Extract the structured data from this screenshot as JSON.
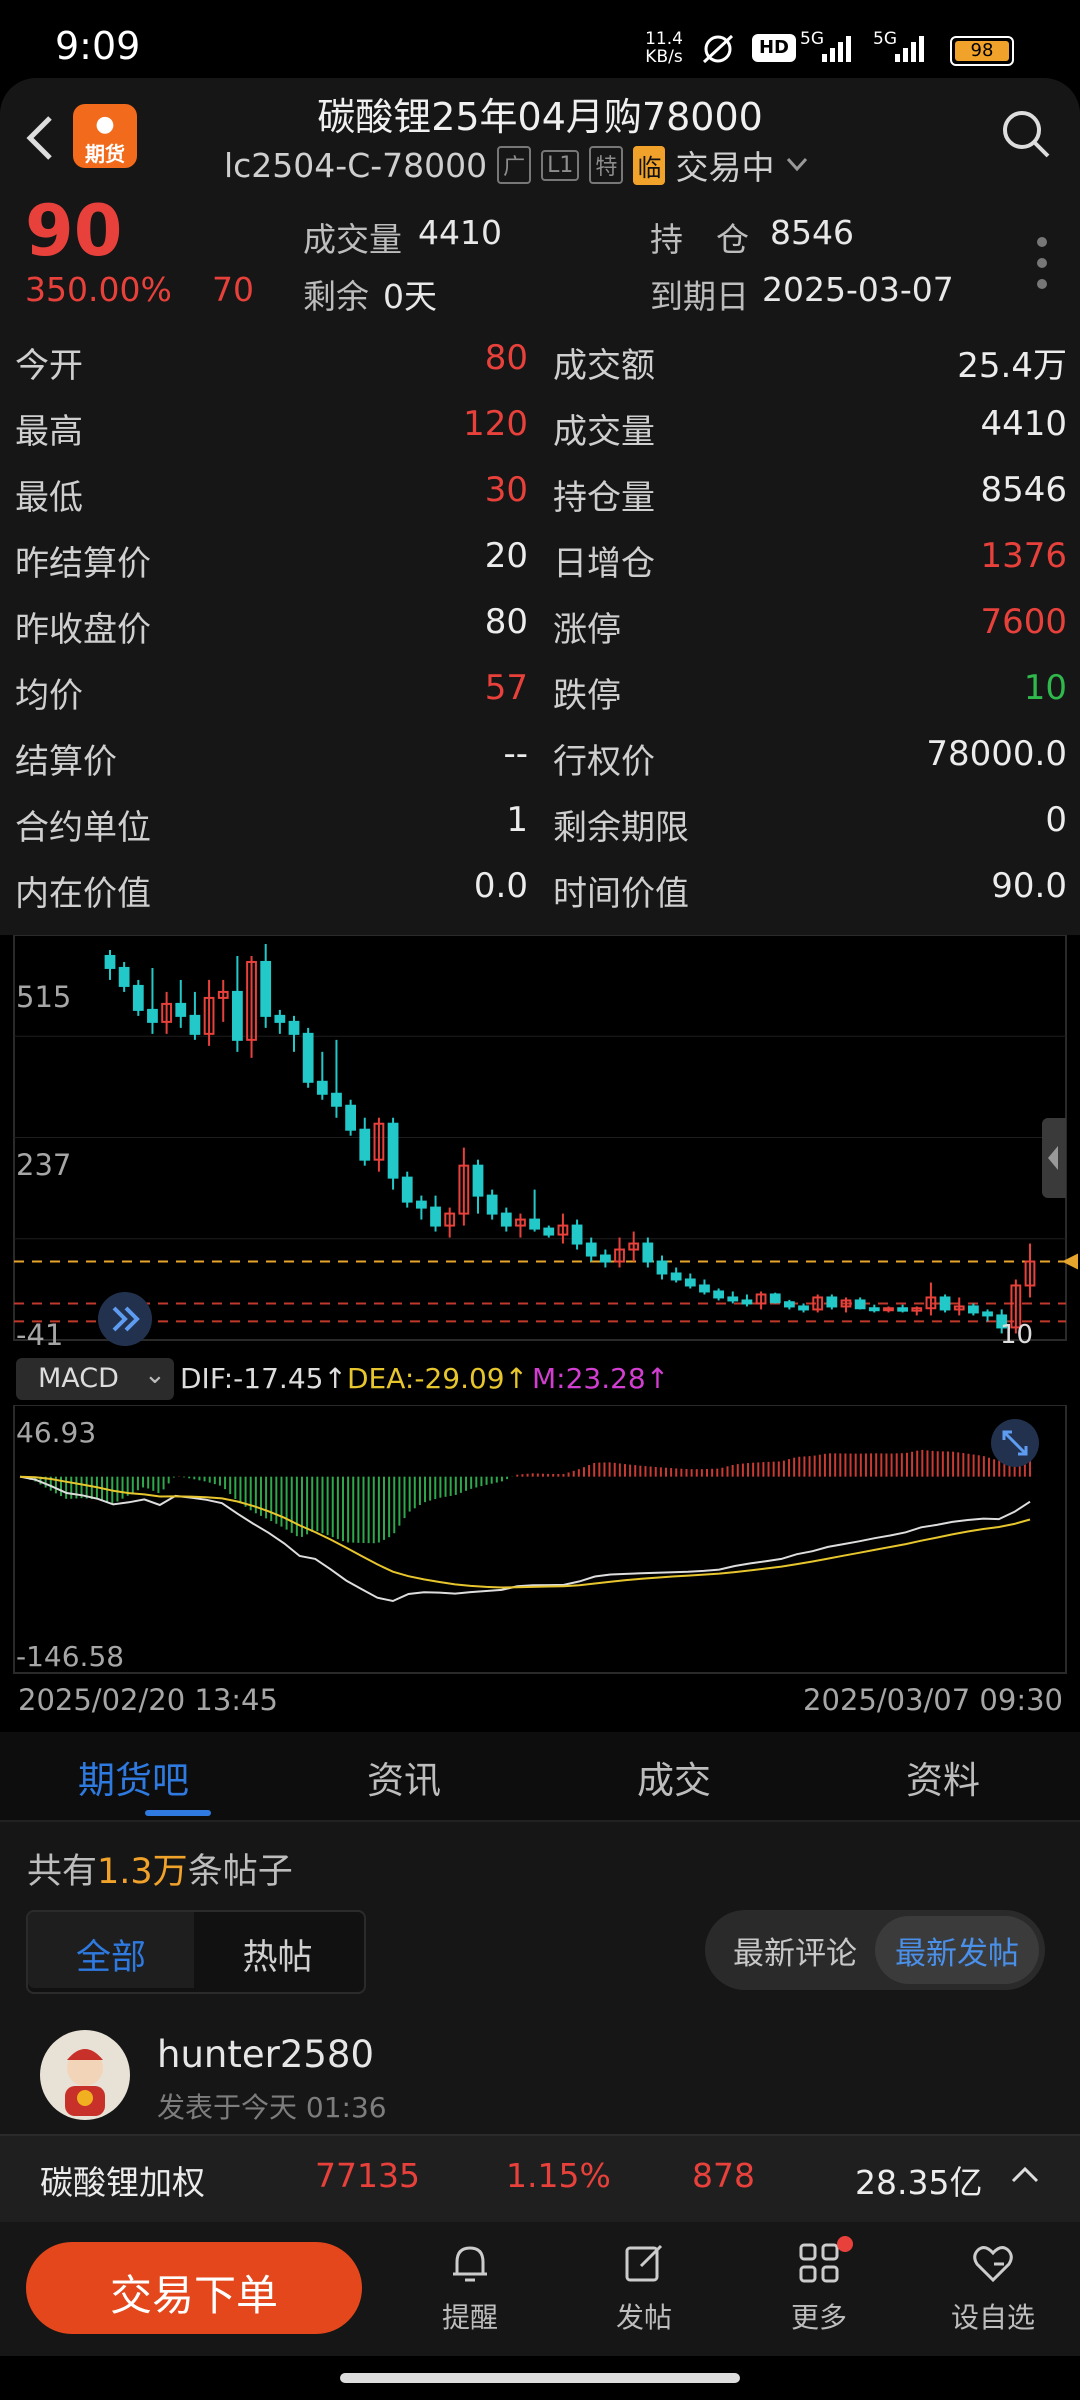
{
  "status_bar": {
    "time": "9:09",
    "net_speed_value": "11.4",
    "net_speed_unit": "KB/s",
    "hd_label": "HD",
    "signal1": "5G",
    "signal2": "5G",
    "battery": "98"
  },
  "header": {
    "logo_top": "●",
    "logo_text": "期货",
    "title": "碳酸锂25年04月购78000",
    "code": "lc2504-C-78000",
    "tags": [
      "广",
      "L1",
      "特"
    ],
    "tag_highlight": "临",
    "trade_status": "交易中"
  },
  "quote": {
    "price": "90",
    "change_pct": "350.00%",
    "change": "70",
    "volume_label": "成交量",
    "volume": "4410",
    "open_interest_label": "持　仓",
    "open_interest": "8546",
    "remaining_label": "剩余",
    "remaining": "0天",
    "expiry_label": "到期日",
    "expiry": "2025-03-07"
  },
  "stats": [
    {
      "l1": "今开",
      "v1": "80",
      "c1": "red",
      "l2": "成交额",
      "v2": "25.4万",
      "c2": "white"
    },
    {
      "l1": "最高",
      "v1": "120",
      "c1": "red",
      "l2": "成交量",
      "v2": "4410",
      "c2": "white"
    },
    {
      "l1": "最低",
      "v1": "30",
      "c1": "red",
      "l2": "持仓量",
      "v2": "8546",
      "c2": "white"
    },
    {
      "l1": "昨结算价",
      "v1": "20",
      "c1": "white",
      "l2": "日增仓",
      "v2": "1376",
      "c2": "red"
    },
    {
      "l1": "昨收盘价",
      "v1": "80",
      "c1": "white",
      "l2": "涨停",
      "v2": "7600",
      "c2": "red"
    },
    {
      "l1": "均价",
      "v1": "57",
      "c1": "red",
      "l2": "跌停",
      "v2": "10",
      "c2": "green"
    },
    {
      "l1": "结算价",
      "v1": "--",
      "c1": "white",
      "l2": "行权价",
      "v2": "78000.0",
      "c2": "white"
    },
    {
      "l1": "合约单位",
      "v1": "1",
      "c1": "white",
      "l2": "剩余期限",
      "v2": "0",
      "c2": "white"
    },
    {
      "l1": "内在价值",
      "v1": "0.0",
      "c1": "white",
      "l2": "时间价值",
      "v2": "90.0",
      "c2": "white"
    }
  ],
  "chart": {
    "y_labels": [
      "515",
      "237",
      "-41"
    ],
    "last_label": "10",
    "macd_selector": "MACD",
    "dif": "DIF:-17.45↑",
    "dea": "DEA:-29.09↑",
    "m": "M:23.28↑",
    "macd_max": "46.93",
    "macd_min": "-146.58",
    "start_time": "2025/02/20 13:45",
    "end_time": "2025/03/07 09:30",
    "colors": {
      "up": "#e8413b",
      "down": "#23c9c9",
      "dif": "#dddddd",
      "dea": "#e7c52d",
      "m": "#d13ed0"
    }
  },
  "chart_data": {
    "type": "candlestick",
    "y_ticks": [
      515,
      237,
      -41
    ],
    "ylim": [
      -41,
      635
    ],
    "candles": [
      [
        600,
        610,
        560,
        580
      ],
      [
        580,
        590,
        540,
        550
      ],
      [
        550,
        560,
        500,
        510
      ],
      [
        510,
        580,
        470,
        490
      ],
      [
        490,
        540,
        470,
        520
      ],
      [
        520,
        560,
        480,
        500
      ],
      [
        500,
        540,
        460,
        470
      ],
      [
        470,
        560,
        450,
        530
      ],
      [
        530,
        560,
        490,
        540
      ],
      [
        540,
        600,
        440,
        460
      ],
      [
        460,
        600,
        430,
        590
      ],
      [
        590,
        620,
        480,
        500
      ],
      [
        500,
        510,
        470,
        490
      ],
      [
        490,
        500,
        440,
        470
      ],
      [
        470,
        480,
        380,
        390
      ],
      [
        390,
        440,
        360,
        370
      ],
      [
        370,
        460,
        330,
        350
      ],
      [
        350,
        360,
        300,
        310
      ],
      [
        310,
        330,
        250,
        260
      ],
      [
        260,
        330,
        240,
        320
      ],
      [
        320,
        330,
        210,
        230
      ],
      [
        230,
        240,
        180,
        190
      ],
      [
        190,
        200,
        160,
        180
      ],
      [
        180,
        200,
        140,
        150
      ],
      [
        150,
        180,
        130,
        170
      ],
      [
        170,
        280,
        150,
        250
      ],
      [
        250,
        260,
        170,
        200
      ],
      [
        200,
        210,
        160,
        170
      ],
      [
        170,
        180,
        140,
        150
      ],
      [
        150,
        170,
        130,
        160
      ],
      [
        160,
        210,
        140,
        145
      ],
      [
        145,
        150,
        130,
        135
      ],
      [
        135,
        170,
        120,
        150
      ],
      [
        150,
        160,
        110,
        120
      ],
      [
        120,
        130,
        90,
        100
      ],
      [
        100,
        110,
        80,
        90
      ],
      [
        90,
        130,
        80,
        110
      ],
      [
        110,
        140,
        90,
        120
      ],
      [
        120,
        130,
        80,
        90
      ],
      [
        90,
        100,
        60,
        70
      ],
      [
        70,
        80,
        55,
        60
      ],
      [
        60,
        70,
        45,
        50
      ],
      [
        50,
        60,
        35,
        40
      ],
      [
        40,
        45,
        25,
        30
      ],
      [
        30,
        40,
        20,
        25
      ],
      [
        25,
        35,
        15,
        20
      ],
      [
        20,
        40,
        10,
        35
      ],
      [
        35,
        38,
        20,
        22
      ],
      [
        22,
        26,
        10,
        15
      ],
      [
        15,
        20,
        5,
        10
      ],
      [
        10,
        35,
        5,
        30
      ],
      [
        30,
        35,
        10,
        15
      ],
      [
        15,
        30,
        5,
        25
      ],
      [
        25,
        30,
        10,
        12
      ],
      [
        12,
        18,
        5,
        10
      ],
      [
        10,
        15,
        5,
        12
      ],
      [
        12,
        18,
        5,
        8
      ],
      [
        8,
        15,
        0,
        12
      ],
      [
        12,
        55,
        0,
        30
      ],
      [
        30,
        35,
        5,
        10
      ],
      [
        10,
        30,
        0,
        15
      ],
      [
        15,
        20,
        0,
        5
      ],
      [
        5,
        10,
        -10,
        0
      ],
      [
        0,
        10,
        -30,
        -20
      ],
      [
        -20,
        60,
        -30,
        50
      ],
      [
        50,
        120,
        30,
        90
      ]
    ],
    "dashed_levels": [
      90,
      20,
      -10
    ]
  }
}
